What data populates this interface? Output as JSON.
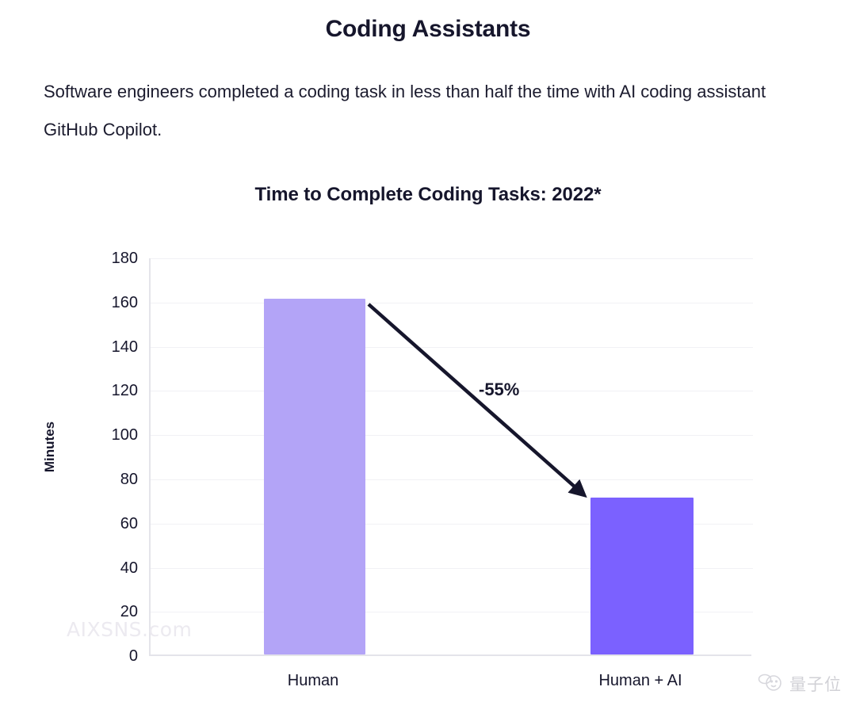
{
  "page": {
    "title": "Coding Assistants",
    "subtitle": "Software engineers completed a coding task in less than half the time with AI coding assistant GitHub Copilot."
  },
  "watermarks": {
    "site": "AIXSNS.com",
    "brand": "量子位",
    "brand_icon": "qbitai-owl-icon"
  },
  "chart_data": {
    "type": "bar",
    "title": "Time to Complete Coding Tasks: 2022*",
    "xlabel": "",
    "ylabel": "Minutes",
    "categories": [
      "Human",
      "Human + AI"
    ],
    "values": [
      161,
      71
    ],
    "colors": [
      "#B3A4F7",
      "#7B61FF"
    ],
    "ylim": [
      0,
      180
    ],
    "yticks": [
      0,
      20,
      40,
      60,
      80,
      100,
      120,
      140,
      160,
      180
    ],
    "ytick_labels": [
      "0",
      "20",
      "40",
      "60",
      "80",
      "100",
      "120",
      "140",
      "160",
      "180"
    ],
    "grid": true,
    "legend": "none",
    "annotations": [
      {
        "text": "-55%",
        "type": "arrow",
        "from_category": "Human",
        "to_category": "Human + AI"
      }
    ]
  }
}
